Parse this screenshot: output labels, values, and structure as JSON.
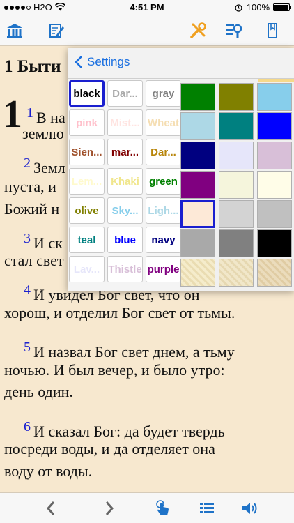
{
  "status_bar": {
    "carrier": "H2O",
    "time": "4:51 PM",
    "battery": "100%"
  },
  "toolbar": {
    "left_icons": [
      "library-icon",
      "notes-icon"
    ],
    "right_icons": [
      "tools-icon",
      "search-icon",
      "bookmark-icon"
    ]
  },
  "colors": {
    "accent": "#1a1fcf",
    "link": "#1a6fe0",
    "page_bg": "#f7e8cf",
    "icon_blue": "#1f73c8",
    "icon_orange": "#f0a020"
  },
  "reader": {
    "chapter_title": "1 Быти",
    "drop_cap": "1",
    "lines": [
      {
        "num": "1",
        "text": "В на"
      },
      {
        "num": "",
        "text": "землю"
      },
      {
        "num": "2",
        "text": "Земл"
      },
      {
        "num": "",
        "text": "пуста, и"
      },
      {
        "num": "",
        "text": "Божий н"
      },
      {
        "num": "3",
        "text": "И ск"
      },
      {
        "num": "",
        "text": "стал свет"
      },
      {
        "num": "4",
        "text": "И увидел Бог свет, что он"
      },
      {
        "num": "",
        "text": "хорош, и отделил Бог свет от тьмы."
      },
      {
        "num": "5",
        "text": "И назвал Бог свет днем, а тьму"
      },
      {
        "num": "",
        "text": "ночью. И был вечер, и было утро:"
      },
      {
        "num": "",
        "text": "день один."
      },
      {
        "num": "6",
        "text": "И сказал Бог: да будет твердь"
      },
      {
        "num": "",
        "text": "посреди воды, и да отделяет она"
      },
      {
        "num": "",
        "text": "воду от воды."
      }
    ]
  },
  "settings_popover": {
    "back_label": "Settings",
    "color_names": [
      {
        "label": "black",
        "color": "#000000",
        "selected": true
      },
      {
        "label": "Dar...",
        "color": "#a9a9a9"
      },
      {
        "label": "gray",
        "color": "#808080"
      },
      {
        "label": "pink",
        "color": "#ffc0cb"
      },
      {
        "label": "Mist...",
        "color": "#ffe4e1"
      },
      {
        "label": "Wheat",
        "color": "#f5deb3"
      },
      {
        "label": "Sien...",
        "color": "#a0522d"
      },
      {
        "label": "mar...",
        "color": "#800000"
      },
      {
        "label": "Dar...",
        "color": "#b8860b"
      },
      {
        "label": "Lem...",
        "color": "#fffacd"
      },
      {
        "label": "Khaki",
        "color": "#f0e68c"
      },
      {
        "label": "green",
        "color": "#008000"
      },
      {
        "label": "olive",
        "color": "#808000"
      },
      {
        "label": "Sky...",
        "color": "#87ceeb"
      },
      {
        "label": "Ligh...",
        "color": "#add8e6"
      },
      {
        "label": "teal",
        "color": "#008080"
      },
      {
        "label": "blue",
        "color": "#0000ff"
      },
      {
        "label": "navy",
        "color": "#000080"
      },
      {
        "label": "Lav...",
        "color": "#e6e6fa"
      },
      {
        "label": "Thistle",
        "color": "#d8bfd8"
      },
      {
        "label": "purple",
        "color": "#800080"
      }
    ],
    "swatches": [
      {
        "color": "#008000"
      },
      {
        "color": "#808000"
      },
      {
        "color": "#87ceeb"
      },
      {
        "color": "#add8e6"
      },
      {
        "color": "#008080"
      },
      {
        "color": "#0000ff"
      },
      {
        "color": "#000080"
      },
      {
        "color": "#e6e6fa"
      },
      {
        "color": "#d8bfd8"
      },
      {
        "color": "#800080"
      },
      {
        "color": "#f5f5dc"
      },
      {
        "color": "#fffde8"
      },
      {
        "color": "#fde9d7",
        "selected": true
      },
      {
        "color": "#d3d3d3"
      },
      {
        "color": "#c0c0c0"
      },
      {
        "color": "#a9a9a9"
      },
      {
        "color": "#808080"
      },
      {
        "color": "#000000"
      },
      {
        "color": "#f3e9c2",
        "texture": "parchment"
      },
      {
        "color": "#efe3c0",
        "texture": "parchment"
      },
      {
        "color": "#e8d6b0",
        "texture": "parchment"
      }
    ]
  },
  "bottom_bar": {
    "icons": [
      "chevron-left-icon",
      "chevron-right-icon",
      "tap-icon",
      "list-icon",
      "speaker-icon"
    ]
  }
}
